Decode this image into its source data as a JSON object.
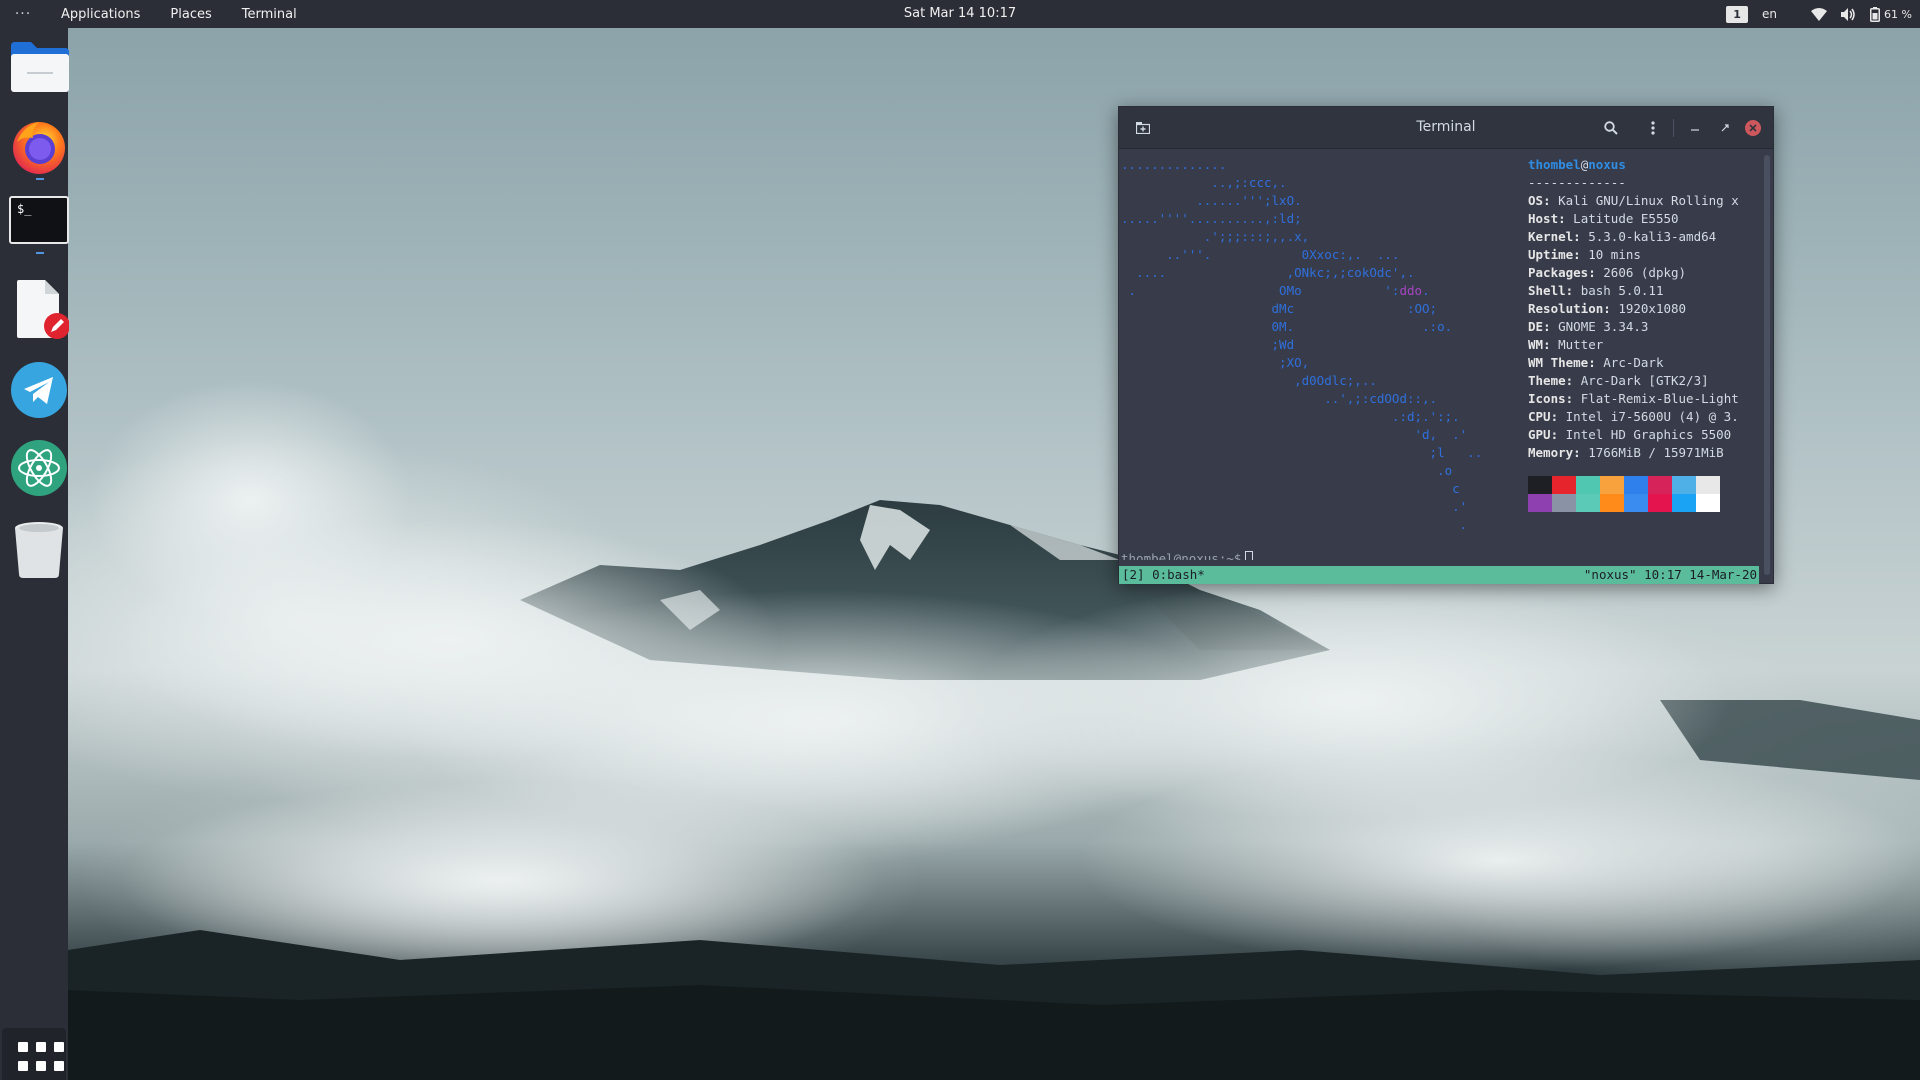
{
  "topbar": {
    "activities_label": "···",
    "menus": [
      "Applications",
      "Places",
      "Terminal"
    ],
    "clock": "Sat Mar 14  10:17",
    "workspace": "1",
    "language": "en",
    "battery": "61 %"
  },
  "dock": {
    "items": [
      {
        "name": "Files",
        "icon": "folder-icon"
      },
      {
        "name": "Firefox",
        "icon": "firefox-icon"
      },
      {
        "name": "Terminal",
        "icon": "terminal-icon",
        "glyph": "$_"
      },
      {
        "name": "Text Editor",
        "icon": "text-editor-icon"
      },
      {
        "name": "Telegram",
        "icon": "telegram-icon"
      },
      {
        "name": "Atom",
        "icon": "atom-icon"
      },
      {
        "name": "Trash",
        "icon": "trash-icon"
      }
    ],
    "show_apps_icon": "app-grid-icon"
  },
  "terminal": {
    "title": "Terminal",
    "neofetch": {
      "user": "thombel",
      "at": "@",
      "host": "noxus",
      "separator": "-------------",
      "fields": [
        {
          "key": "OS",
          "value": "Kali GNU/Linux Rolling x"
        },
        {
          "key": "Host",
          "value": "Latitude E5550"
        },
        {
          "key": "Kernel",
          "value": "5.3.0-kali3-amd64"
        },
        {
          "key": "Uptime",
          "value": "10 mins"
        },
        {
          "key": "Packages",
          "value": "2606 (dpkg)"
        },
        {
          "key": "Shell",
          "value": "bash 5.0.11"
        },
        {
          "key": "Resolution",
          "value": "1920x1080"
        },
        {
          "key": "DE",
          "value": "GNOME 3.34.3"
        },
        {
          "key": "WM",
          "value": "Mutter"
        },
        {
          "key": "WM Theme",
          "value": "Arc-Dark"
        },
        {
          "key": "Theme",
          "value": "Arc-Dark [GTK2/3]"
        },
        {
          "key": "Icons",
          "value": "Flat-Remix-Blue-Light"
        },
        {
          "key": "CPU",
          "value": "Intel i7-5600U (4) @ 3."
        },
        {
          "key": "GPU",
          "value": "Intel HD Graphics 5500"
        },
        {
          "key": "Memory",
          "value": "1766MiB / 15971MiB"
        }
      ],
      "palette_top": [
        "#1e1f24",
        "#e5242b",
        "#4fc7b1",
        "#f7a23c",
        "#2f80ed",
        "#d6245a",
        "#4fb0e8",
        "#e8e8e8"
      ],
      "palette_bottom": [
        "#8e3fb0",
        "#8a93a6",
        "#5bcbb8",
        "#ff8c1a",
        "#3a8cf0",
        "#e4144f",
        "#1aa3f5",
        "#ffffff"
      ]
    },
    "ascii_lines": [
      "..............",
      "            ..,;:ccc,.",
      "          ......''';lxO.",
      ".....''''..........,:ld;",
      "           .';;;:::;,,.x,",
      "      ..'''.            0Xxoc:,.  ...",
      "  ....                ,ONkc;,;cokOdc',.",
      " .                   OMo           ':ddo.",
      "                    dMc               :OO;",
      "                    0M.                 .:o.",
      "                    ;Wd",
      "                     ;XO,",
      "                       ,d0Odlc;,..",
      "                           ..',;:cdOOd::,.",
      "                                    .:d;.':;.",
      "                                       'd,  .'",
      "                                         ;l   ..",
      "                                          .o",
      "                                            c",
      "                                            .'",
      "                                             ."
    ],
    "prompt": "thombel@noxus:~$",
    "tmux_left": "[2] 0:bash*",
    "tmux_right": "\"noxus\" 10:17 14-Mar-20"
  }
}
